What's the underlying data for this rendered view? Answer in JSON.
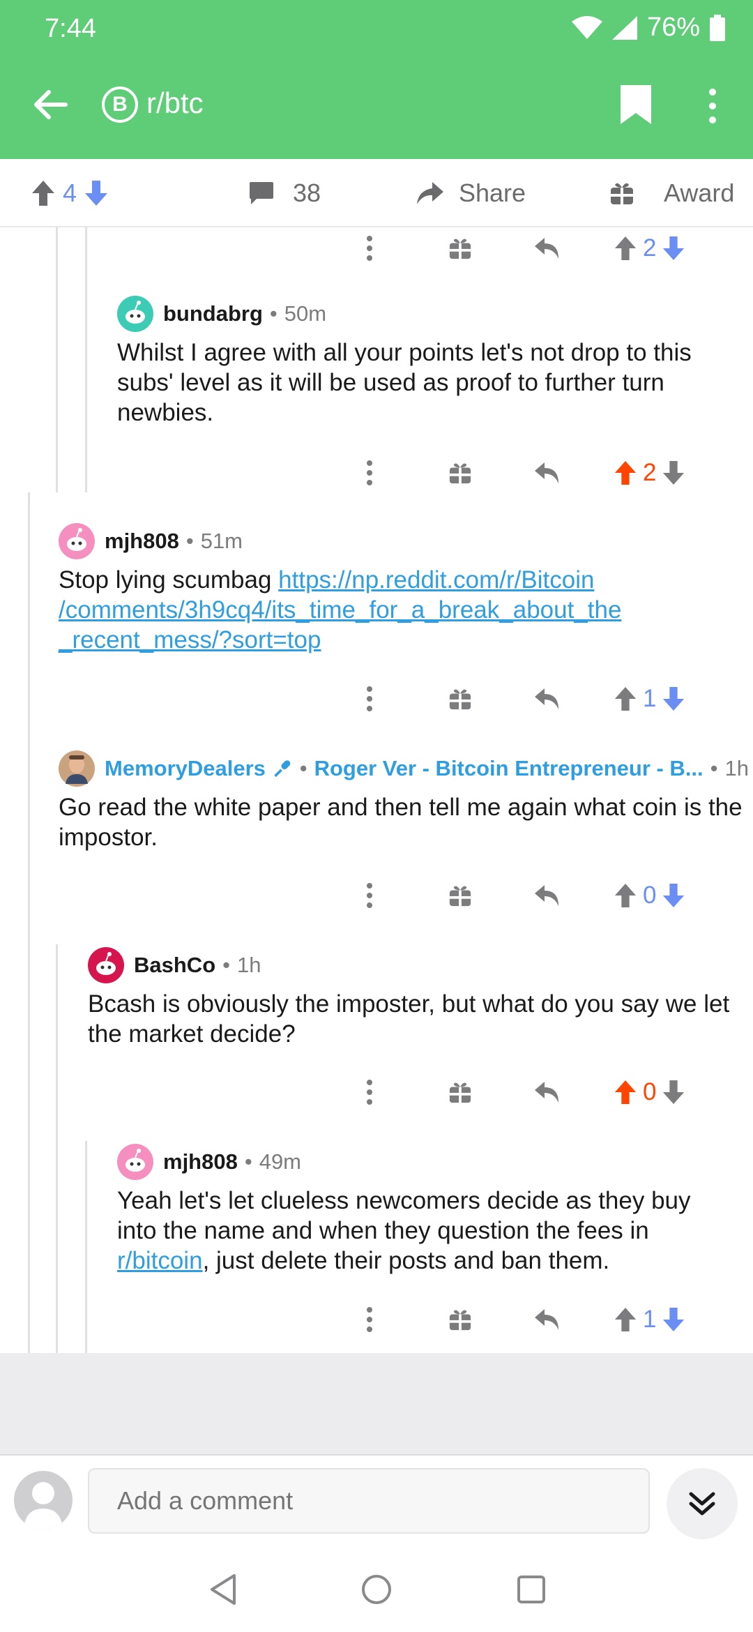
{
  "status": {
    "time": "7:44",
    "battery": "76%"
  },
  "appbar": {
    "subreddit": "r/btc",
    "sub_icon_glyph": "B"
  },
  "post_actions": {
    "score": "4",
    "comments": "38",
    "share": "Share",
    "award": "Award"
  },
  "comments": [
    {
      "score": "2",
      "vote": "none"
    },
    {
      "author": "bundabrg",
      "time": "50m",
      "body": "Whilst I agree with all your points let's not drop to this subs' level as it will be used as proof to further turn newbies.",
      "score": "2",
      "vote": "up"
    },
    {
      "author": "mjh808",
      "time": "51m",
      "body_prefix": "Stop lying scumbag ",
      "link_lines": [
        "https://np.reddit.com/r/Bitcoin",
        "/comments/3h9cq4/its_time_for_a_break_about_the",
        "_recent_mess/?sort=top"
      ],
      "score": "1",
      "vote": "none"
    },
    {
      "author": "MemoryDealers",
      "flair": "Roger Ver - Bitcoin Entrepreneur - B...",
      "time": "1h",
      "body": "Go read the white paper and then tell me again what coin is the impostor.",
      "score": "0",
      "vote": "none"
    },
    {
      "author": "BashCo",
      "time": "1h",
      "body": "Bcash is obviously the imposter, but what do you say we let the market decide?",
      "score": "0",
      "vote": "up"
    },
    {
      "author": "mjh808",
      "time": "49m",
      "body_prefix": "Yeah let's let clueless newcomers decide as they buy into the name and when they question the fees in ",
      "link_text": "r/bitcoin",
      "body_suffix": ", just delete their posts and ban them.",
      "score": "1",
      "vote": "none"
    }
  ],
  "composer": {
    "placeholder": "Add a comment"
  },
  "colors": {
    "header_green": "#5fcc77",
    "upvote_orange": "#ff4500",
    "downvote_blue": "#6a8ef4",
    "link_blue": "#2f9ee0"
  }
}
